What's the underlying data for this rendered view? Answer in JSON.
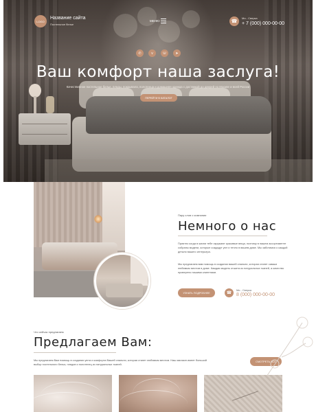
{
  "header": {
    "logo_text": "LOGO",
    "site_name": "Название сайта",
    "site_sub": "Постельное белье",
    "menu_label": "МЕНЮ",
    "phone_note": "Ми - Сверка",
    "phone": "+ 7 (000) 000-00-00"
  },
  "hero": {
    "socials": [
      "whatsapp-icon",
      "vk-icon",
      "viber-icon",
      "telegram-icon"
    ],
    "title": "Ваш комфорт наша заслуга!",
    "description": "Качественное постельное белье, пледы, покрывала, полотенца и домашняя одежда с доставкой до дверей по Москве и всей России",
    "button": "ПЕРЕЙТИ В КАТАЛОГ"
  },
  "about": {
    "pretitle": "Пару слов о компании",
    "title": "Немного о нас",
    "p1": "Приятно когда в жизни тебе окружают красивые вещи, поэтому в нашем ассортименте собраны модели, которые создадут уют и тепло в вашем доме. Мы заботимся о каждой детали вашего интерьера.",
    "p2": "Мы предлагаем вам помощь в создании вашей спальни, которая станет самым любимым местом в доме. Каждая модель отшита из натуральных тканей, а качество проверено нашими клиентами.",
    "button": "УЗНАТЬ ПОДРОБНЕЕ",
    "phone_note": "Ми - Сверка",
    "phone": "8 (000) 000-00-00"
  },
  "offer": {
    "pretitle": "Что сейчас предлагаем",
    "title": "Предлагаем Вам:",
    "description": "Мы предлагаем Вам помощь в создании уюта и комфорта Вашей спальни, которая станет любимым местом. Наш магазин имеет большой выбор постельного белья, пледов и полотенец из натуральных тканей.",
    "button": "СМОТРЕТЬ ВСЕ"
  },
  "colors": {
    "accent": "#c39274",
    "text": "#2b2b2b"
  }
}
